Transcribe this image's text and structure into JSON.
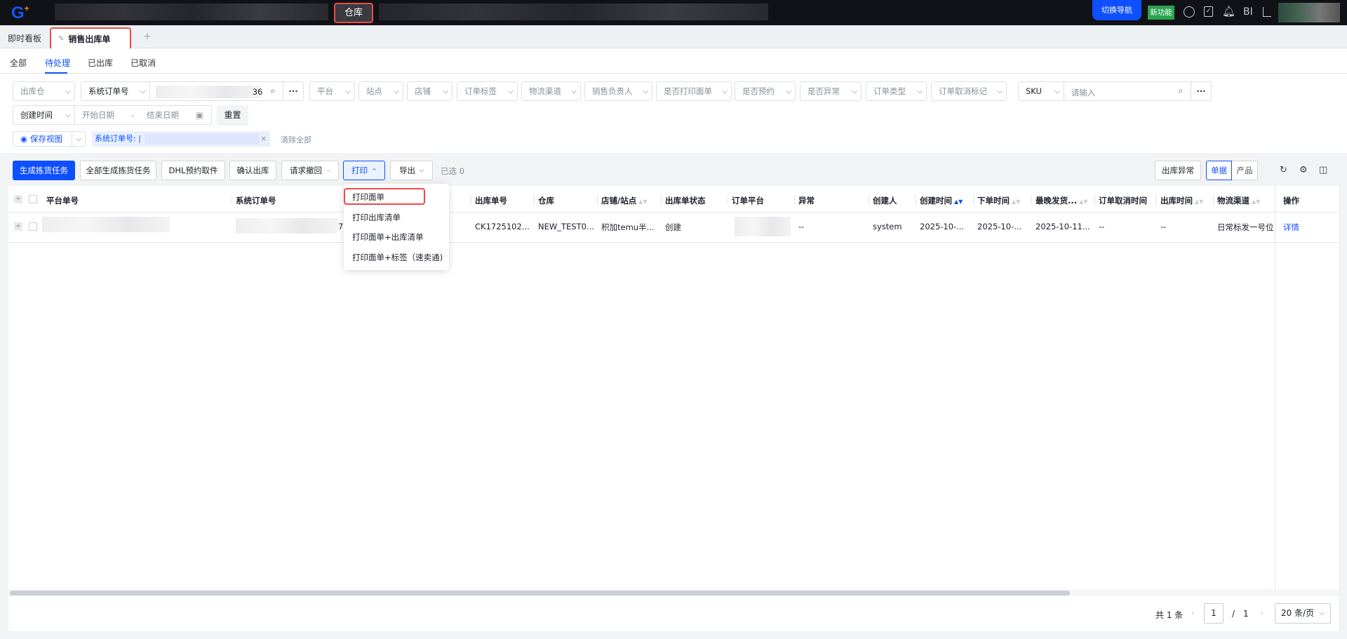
{
  "topbar": {
    "active_module": "仓库",
    "switch_nav": "切换导航",
    "new_feature": "新功能",
    "bi": "BI"
  },
  "tabs": {
    "dashboard": "即时看板",
    "active": "销售出库单",
    "add": "+"
  },
  "status_tabs": [
    "全部",
    "待处理",
    "已出库",
    "已取消"
  ],
  "filters": {
    "warehouse": "出库仓",
    "order_type_select": "系统订单号",
    "order_search_value": "36",
    "items": [
      "平台",
      "站点",
      "店铺",
      "订单标签",
      "物流渠道",
      "销售负责人",
      "是否打印面单",
      "是否预约",
      "是否异常",
      "订单类型",
      "订单取消标记"
    ],
    "sku_select": "SKU",
    "sku_placeholder": "请输入",
    "date_type": "创建时间",
    "start_placeholder": "开始日期",
    "end_placeholder": "结束日期",
    "date_sep": "-",
    "reset": "重置",
    "save_view": "保存视图",
    "active_tag": "系统订单号: |",
    "clear_all": "清除全部"
  },
  "actions": {
    "generate": "生成拣货任务",
    "generate_all": "全部生成拣货任务",
    "dhl": "DHL预约取件",
    "confirm": "确认出库",
    "withdraw": "请求撤回",
    "print": "打印",
    "export": "导出",
    "selected": "已选 0",
    "exception": "出库异常",
    "view_doc": "单据",
    "view_product": "产品"
  },
  "print_menu": [
    "打印面单",
    "打印出库清单",
    "打印面单+出库清单",
    "打印面单+标签（速卖通)"
  ],
  "table": {
    "headers": [
      "平台单号",
      "系统订单号",
      "出库单号",
      "仓库",
      "店铺/站点",
      "出库单状态",
      "订单平台",
      "异常",
      "创建人",
      "创建时间",
      "下单时间",
      "最晚发货...",
      "订单取消时间",
      "出库时间",
      "物流渠道",
      "操作"
    ],
    "rows": [
      {
        "sys_order_suffix": "7",
        "outbound_no": "CK1725102...",
        "warehouse": "NEW_TEST0...",
        "store": "积加temu半...",
        "status": "创建",
        "exception": "--",
        "creator": "system",
        "created": "2025-10-...",
        "ordered": "2025-10-...",
        "latest_ship": "2025-10-11...",
        "cancel_time": "--",
        "out_time": "--",
        "channel": "日常标发一号位",
        "action": "详情"
      }
    ]
  },
  "pagination": {
    "total": "共 1 条",
    "page": "1",
    "sep": "/",
    "pages": "1",
    "page_size": "20 条/页"
  },
  "colors": {
    "primary": "#0e4fff",
    "highlight": "#f04a47",
    "green": "#2aa44f"
  }
}
